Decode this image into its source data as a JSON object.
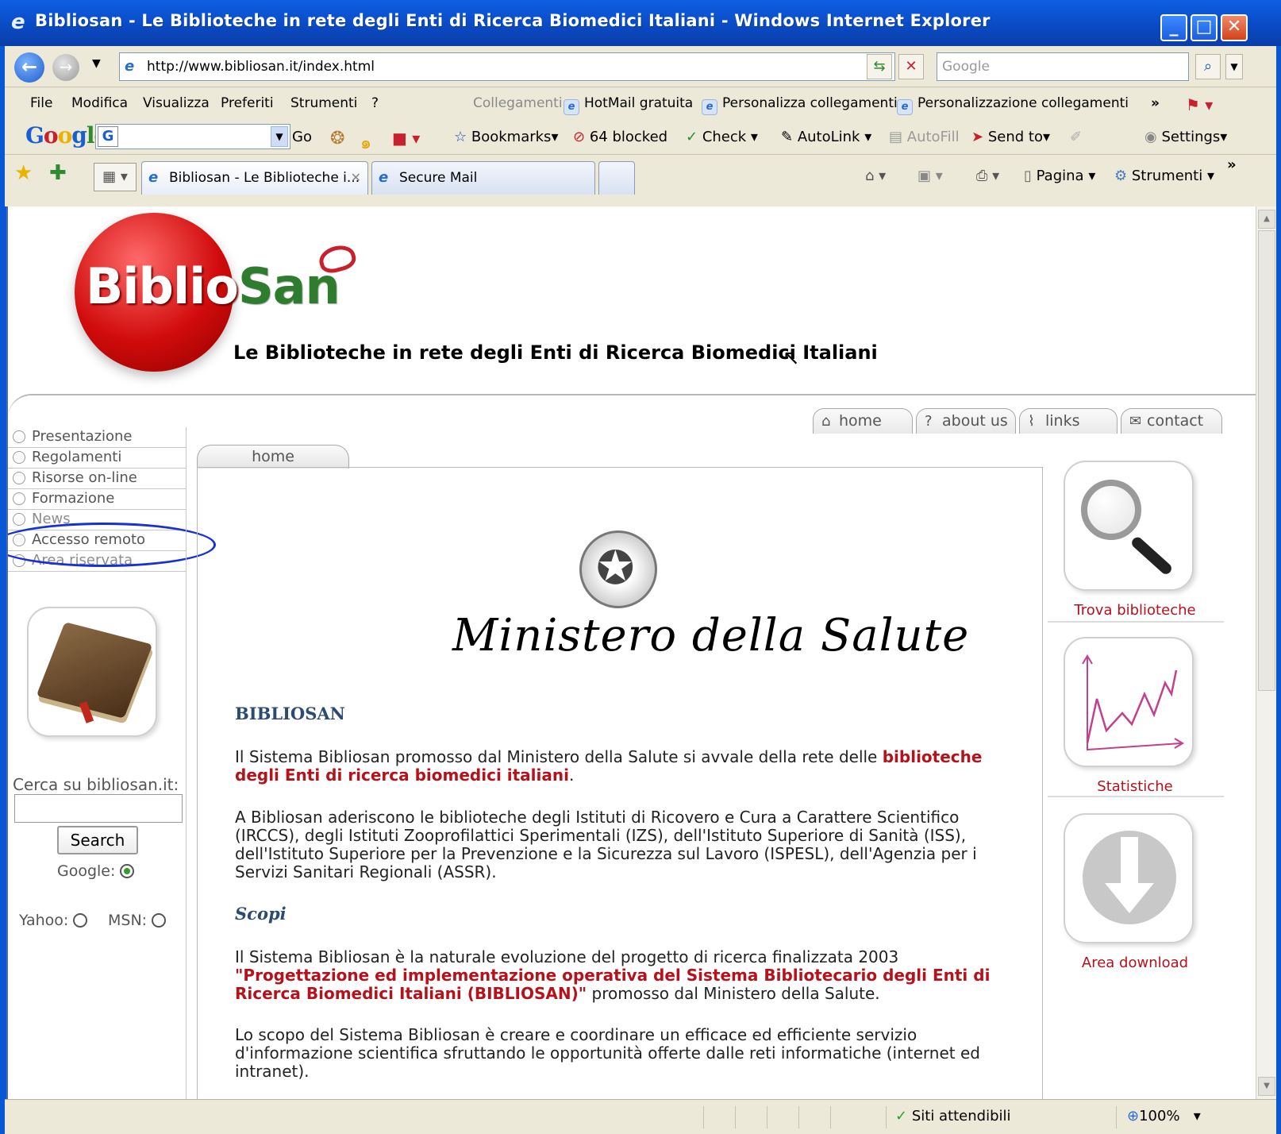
{
  "window": {
    "title": "Bibliosan - Le Biblioteche in rete degli Enti di Ricerca Biomedici Italiani - Windows Internet Explorer",
    "address": "http://www.bibliosan.it/index.html",
    "search_placeholder": "Google"
  },
  "menu": {
    "items": [
      "File",
      "Modifica",
      "Visualizza",
      "Preferiti",
      "Strumenti",
      "?"
    ],
    "links_label": "Collegamenti",
    "links": [
      "HotMail gratuita",
      "Personalizza collegamenti",
      "Personalizzazione collegamenti"
    ],
    "overflow": "»"
  },
  "google_toolbar": {
    "logo": "Google",
    "go": "Go",
    "bookmarks": "Bookmarks",
    "blocked": "64 blocked",
    "check": "Check",
    "autolink": "AutoLink",
    "autofill": "AutoFill",
    "send_to": "Send to",
    "settings": "Settings"
  },
  "tabs": [
    {
      "label": "Bibliosan - Le Biblioteche i..."
    },
    {
      "label": "Secure Mail"
    }
  ],
  "command_bar": {
    "page": "Pagina",
    "tools": "Strumenti"
  },
  "page": {
    "logo_a": "Biblio",
    "logo_b": "San",
    "tagline": "Le Biblioteche in rete degli Enti di Ricerca Biomedici Italiani",
    "topnav": [
      "home",
      "about us",
      "links",
      "contact"
    ],
    "leftmenu": [
      "Presentazione",
      "Regolamenti",
      "Risorse on-line",
      "Formazione",
      "News",
      "Accesso remoto",
      "Area riservata"
    ],
    "search_label": "Cerca su bibliosan.it:",
    "search_button": "Search",
    "engines": {
      "google": "Google:",
      "yahoo": "Yahoo:",
      "msn": "MSN:"
    },
    "content_tab": "home",
    "ministero": "Ministero della Salute",
    "heading": "BIBLIOSAN",
    "p1_a": "Il Sistema Bibliosan promosso dal Ministero della Salute si avvale della rete delle ",
    "p1_b": "biblioteche degli Enti di ricerca biomedici italiani",
    "p1_c": ".",
    "p2": "A Bibliosan aderiscono le biblioteche degli Istituti di Ricovero e Cura a Carattere Scientifico (IRCCS), degli Istituti Zooprofilattici Sperimentali (IZS), dell'Istituto Superiore di Sanità (ISS), dell'Istituto Superiore per la Prevenzione e la Sicurezza sul Lavoro (ISPESL), dell'Agenzia per i Servizi Sanitari Regionali (ASSR).",
    "scopi": "Scopi",
    "p3_a": "Il Sistema Bibliosan è la naturale evoluzione del progetto di ricerca finalizzata 2003 ",
    "p3_b": "\"Progettazione ed implementazione operativa del Sistema Bibliotecario degli Enti di Ricerca Biomedici Italiani (BIBLIOSAN)\"",
    "p3_c": " promosso dal Ministero della Salute.",
    "p4": "Lo scopo del Sistema Bibliosan è creare e coordinare un efficace ed efficiente servizio d'informazione scientifica sfruttando le opportunità offerte dalle reti informatiche (internet ed intranet).",
    "right": [
      "Trova biblioteche",
      "Statistiche",
      "Area download"
    ]
  },
  "status": {
    "zone": "Siti attendibili",
    "zoom": "100%"
  }
}
